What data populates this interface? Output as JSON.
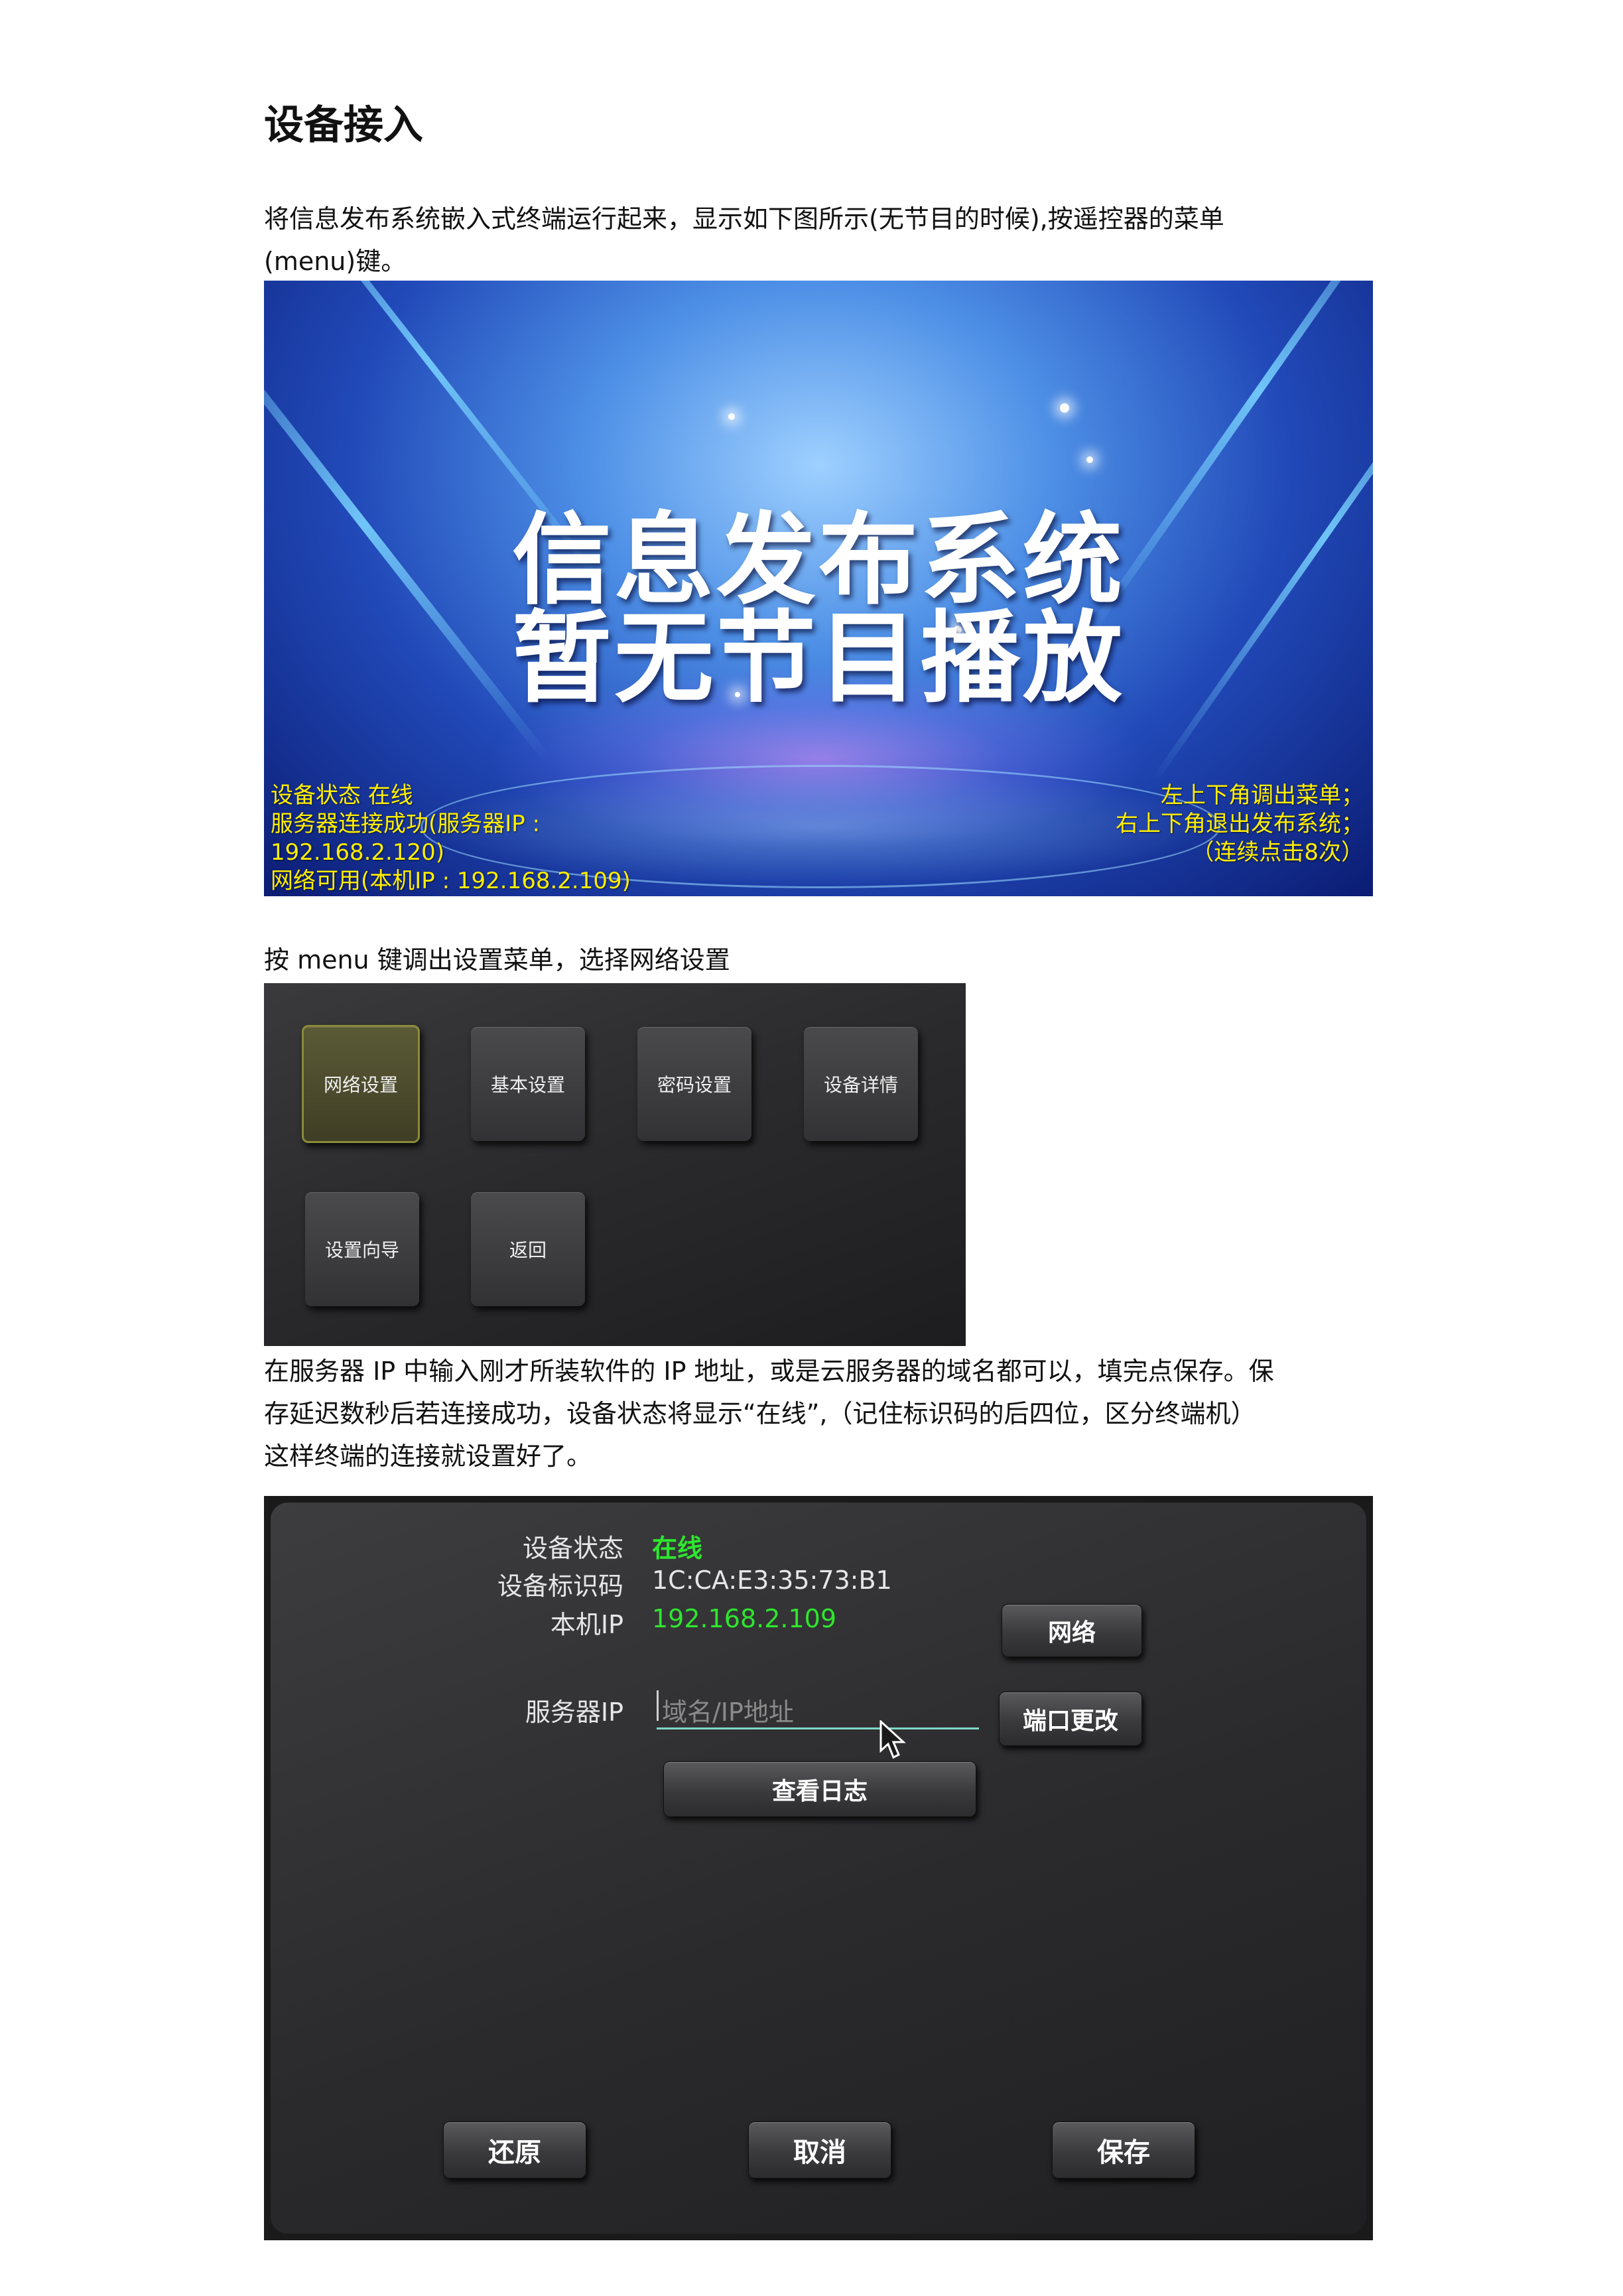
{
  "heading": "设备接入",
  "paragraphs": {
    "p1_line1": "将信息发布系统嵌入式终端运行起来，显示如下图所示(无节目的时候),按遥控器的菜单",
    "p1_line2": "(menu)键。",
    "p2": "按 menu 键调出设置菜单，选择网络设置",
    "p3_line1": "在服务器 IP 中输入刚才所装软件的 IP 地址，或是云服务器的域名都可以，填完点保存。保",
    "p3_line2": "存延迟数秒后若连接成功，设备状态将显示“在线”,（记住标识码的后四位，区分终端机）",
    "p3_line3": "这样终端的连接就设置好了。"
  },
  "splash": {
    "title_line1": "信息发布系统",
    "title_line2": "暂无节目播放",
    "status_left": [
      "设备状态  在线",
      "服务器连接成功(服务器IP :",
      "192.168.2.120)",
      "网络可用(本机IP : 192.168.2.109)"
    ],
    "hint_right": [
      "左上下角调出菜单；",
      "右上下角退出发布系统；",
      "（连续点击8次）"
    ],
    "colors": {
      "text_yellow": "#ffee00",
      "bg_blue": "#2149b8"
    }
  },
  "menu": {
    "items": [
      {
        "label": "网络设置",
        "selected": true
      },
      {
        "label": "基本设置",
        "selected": false
      },
      {
        "label": "密码设置",
        "selected": false
      },
      {
        "label": "设备详情",
        "selected": false
      },
      {
        "label": "设置向导",
        "selected": false
      },
      {
        "label": "返回",
        "selected": false
      }
    ]
  },
  "settings": {
    "status_label": "设备状态",
    "status_value": "在线",
    "id_label": "设备标识码",
    "id_value": "1C:CA:E3:35:73:B1",
    "local_ip_label": "本机IP",
    "local_ip_value": "192.168.2.109",
    "server_ip_label": "服务器IP",
    "server_ip_placeholder": "域名/IP地址",
    "network_button": "网络",
    "port_button": "端口更改",
    "log_button": "查看日志",
    "restore_button": "还原",
    "cancel_button": "取消",
    "save_button": "保存",
    "colors": {
      "online_green": "#2ee62e",
      "ip_green": "#2ee62e",
      "input_underline": "#7fd8c8"
    }
  }
}
